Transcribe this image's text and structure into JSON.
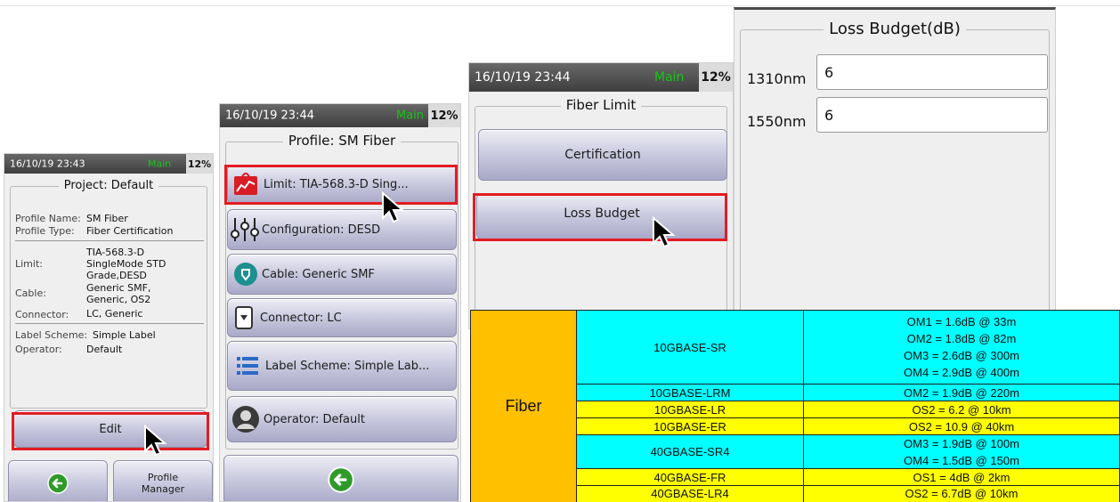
{
  "status": {
    "screen1_time": "16/10/19 23:43",
    "screen2_time": "16/10/19 23:44",
    "screen3_time": "16/10/19 23:44",
    "mode": "Main",
    "battery": "12%"
  },
  "project_screen": {
    "title": "Project: Default",
    "profile_name_label": "Profile Name:",
    "profile_name_value": "SM Fiber",
    "profile_type_label": "Profile Type:",
    "profile_type_value": "Fiber Certification",
    "limit_label": "Limit:",
    "limit_value_1": "TIA-568.3-D",
    "limit_value_2": "SingleMode STD",
    "limit_value_3": "Grade,DESD",
    "cable_label": "Cable:",
    "cable_value_1": "Generic SMF,",
    "cable_value_2": "Generic, OS2",
    "connector_label": "Connector:",
    "connector_value": "LC, Generic",
    "label_scheme_label": "Label Scheme:",
    "label_scheme_value": "Simple Label",
    "operator_label": "Operator:",
    "operator_value": "Default",
    "edit_label": "Edit",
    "profile_manager_line1": "Profile",
    "profile_manager_line2": "Manager"
  },
  "profile_screen": {
    "title": "Profile: SM Fiber",
    "limit_label": "Limit: TIA-568.3-D Sing...",
    "configuration_label": "Configuration: DESD",
    "cable_label": "Cable: Generic SMF",
    "connector_label": "Connector: LC",
    "label_scheme_label": "Label Scheme: Simple Lab...",
    "operator_label": "Operator: Default"
  },
  "fiber_limit_screen": {
    "title": "Fiber Limit",
    "certification_label": "Certification",
    "loss_budget_label": "Loss Budget"
  },
  "loss_budget_screen": {
    "title": "Loss Budget(dB)",
    "wl1_label": "1310nm",
    "wl1_value": "6",
    "wl2_label": "1550nm",
    "wl2_value": "6"
  },
  "fiber_table": {
    "group_label": "Fiber",
    "rows": [
      {
        "standard": "10GBASE-SR",
        "values": [
          "OM1 = 1.6dB @ 33m",
          "OM2 = 1.8dB @ 82m",
          "OM3 = 2.6dB @ 300m",
          "OM4 = 2.9dB @ 400m"
        ]
      },
      {
        "standard": "10GBASE-LRM",
        "values": [
          "OM2 = 1.9dB @ 220m"
        ]
      },
      {
        "standard": "10GBASE-LR",
        "values": [
          "OS2 = 6.2 @ 10km"
        ]
      },
      {
        "standard": "10GBASE-ER",
        "values": [
          "OS2 = 10.9 @ 40km"
        ]
      },
      {
        "standard": "40GBASE-SR4",
        "values": [
          "OM3 = 1.9dB @ 100m",
          "OM4 = 1.5dB @ 150m"
        ]
      },
      {
        "standard": "40GBASE-FR",
        "values": [
          "OS1 = 4dB @ 2km"
        ]
      },
      {
        "standard": "40GBASE-LR4",
        "values": [
          "OS2 = 6.7dB @ 10km"
        ]
      }
    ]
  },
  "colors": {
    "cyan": "#00ffff",
    "yellow": "#ffff00",
    "orange": "#ffc000",
    "highlight": "#e31b23",
    "main_green": "#18c418"
  },
  "icons": [
    "limit-chart-icon",
    "configuration-sliders-icon",
    "cable-icon",
    "connector-icon",
    "label-scheme-icon",
    "operator-icon",
    "back-arrow-icon",
    "mouse-pointer-icon"
  ]
}
